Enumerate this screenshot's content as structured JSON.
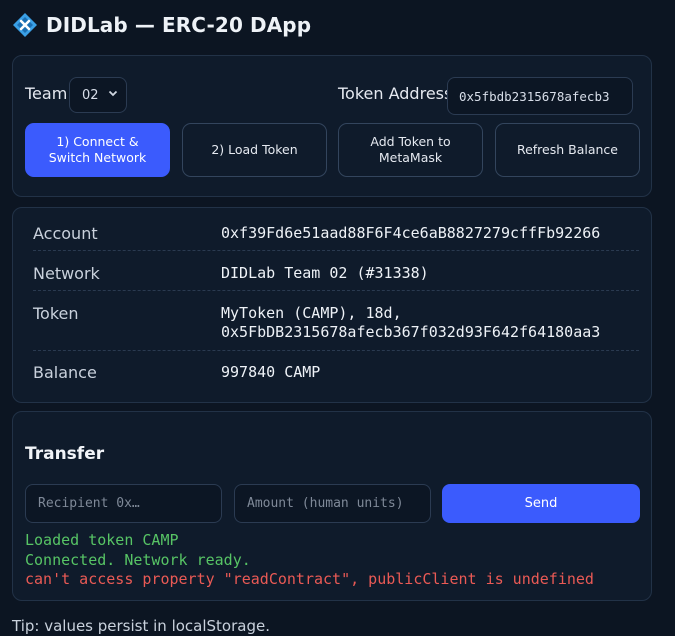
{
  "app": {
    "title": "DIDLab — ERC-20 DApp",
    "logo_icon": "diamond-cross-icon",
    "accent_color": "#3b5bfd"
  },
  "controls": {
    "team_label": "Team",
    "team_value": "02",
    "token_address_label": "Token Address",
    "token_address_value": "0x5fbdb2315678afecb3",
    "buttons": {
      "connect": "1) Connect & Switch Network",
      "load": "2) Load Token",
      "add_to_metamask": "Add Token to MetaMask",
      "refresh": "Refresh Balance"
    }
  },
  "info": {
    "account_label": "Account",
    "account_value": "0xf39Fd6e51aad88F6F4ce6aB8827279cffFb92266",
    "network_label": "Network",
    "network_value": "DIDLab Team 02 (#31338)",
    "token_label": "Token",
    "token_value_line1": "MyToken (CAMP), 18d,",
    "token_value_line2": "0x5FbDB2315678afecb367f032d93F642f64180aa3",
    "balance_label": "Balance",
    "balance_value": "997840 CAMP"
  },
  "transfer": {
    "title": "Transfer",
    "recipient_placeholder": "Recipient 0x…",
    "amount_placeholder": "Amount (human units)",
    "send_label": "Send",
    "log": {
      "line1": "Loaded token CAMP",
      "line2": "Connected. Network ready.",
      "line3": "can't access property \"readContract\", publicClient is undefined"
    },
    "log_colors": {
      "success": "#57c465",
      "error": "#ea5a55"
    }
  },
  "footer": {
    "tip": "Tip: values persist in localStorage."
  }
}
